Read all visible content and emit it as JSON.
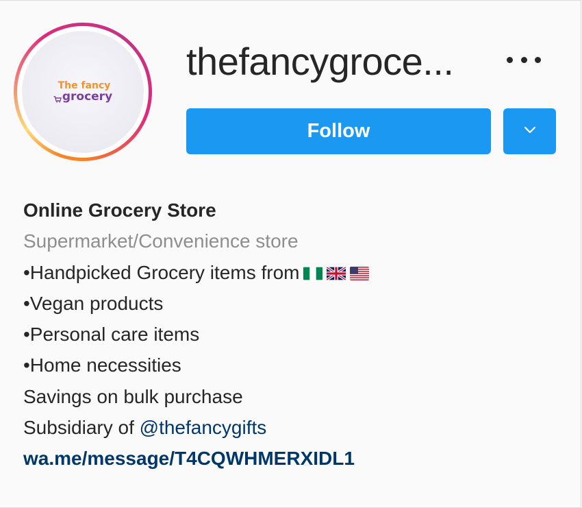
{
  "profile": {
    "username": "thefancygroce...",
    "logo": {
      "line1": "The fancy",
      "line2": "grocery"
    },
    "follow_label": "Follow",
    "more_icon": "more-horizontal-icon",
    "dropdown_icon": "chevron-down-icon"
  },
  "bio": {
    "name": "Online Grocery Store",
    "category": "Supermarket/Convenience store",
    "lines": [
      "•Handpicked Grocery items from",
      "•Vegan products",
      "•Personal care items",
      "•Home necessities",
      "Savings on bulk purchase"
    ],
    "flags": [
      "nigeria-flag-icon",
      "uk-flag-icon",
      "usa-flag-icon"
    ],
    "subsidiary_prefix": "Subsidiary of ",
    "subsidiary_mention": "@thefancygifts",
    "link": "wa.me/message/T4CQWHMERXIDL1"
  },
  "colors": {
    "follow_button": "#1a98f2",
    "mention": "#00376b",
    "category": "#8e8e8e",
    "text": "#262626"
  }
}
